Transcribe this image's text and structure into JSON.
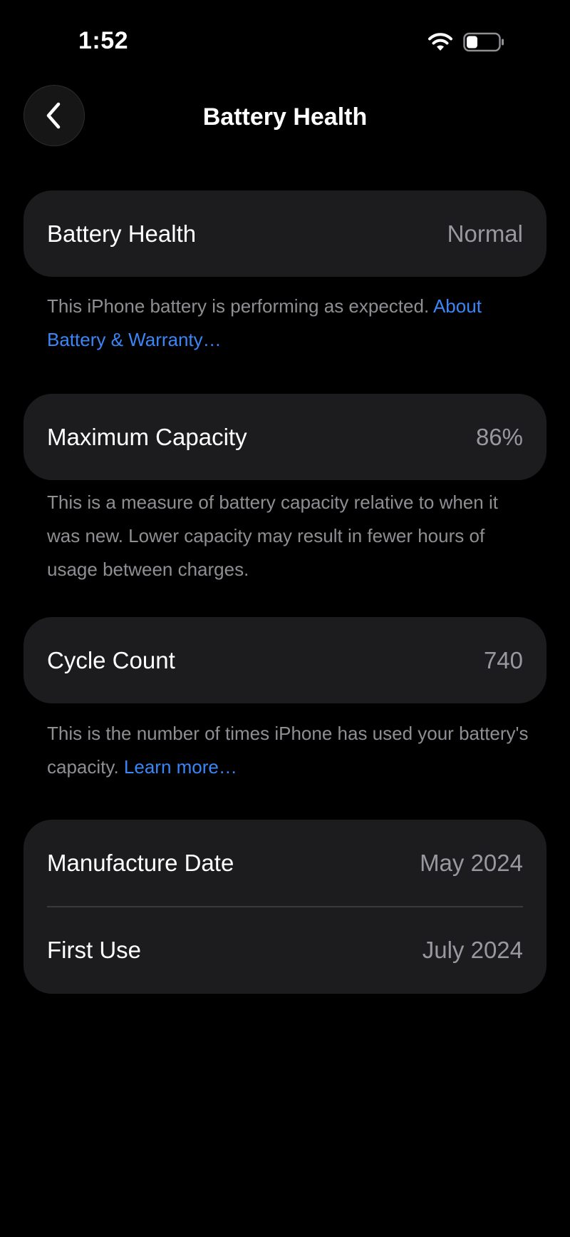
{
  "status_bar": {
    "time": "1:52",
    "wifi_icon": "wifi-icon",
    "battery_icon": "battery-icon",
    "battery_level": 0.35
  },
  "nav": {
    "back_icon": "chevron-left-icon",
    "title": "Battery Health"
  },
  "battery_health": {
    "label": "Battery Health",
    "value": "Normal",
    "footnote": "This iPhone battery is performing as expected.",
    "link": "About Battery & Warranty…"
  },
  "maximum_capacity": {
    "label": "Maximum Capacity",
    "value": "86%",
    "footnote": "This is a measure of battery capacity relative to when it was new. Lower capacity may result in fewer hours of usage between charges."
  },
  "cycle_count": {
    "label": "Cycle Count",
    "value": "740",
    "footnote": "This is the number of times iPhone has used your battery's capacity.",
    "link": "Learn more…"
  },
  "dates": {
    "manufacture_label": "Manufacture Date",
    "manufacture_value": "May 2024",
    "first_use_label": "First Use",
    "first_use_value": "July 2024"
  },
  "colors": {
    "background": "#000000",
    "card": "#1c1c1e",
    "secondary_text": "#98989f",
    "link": "#3a86f7"
  }
}
